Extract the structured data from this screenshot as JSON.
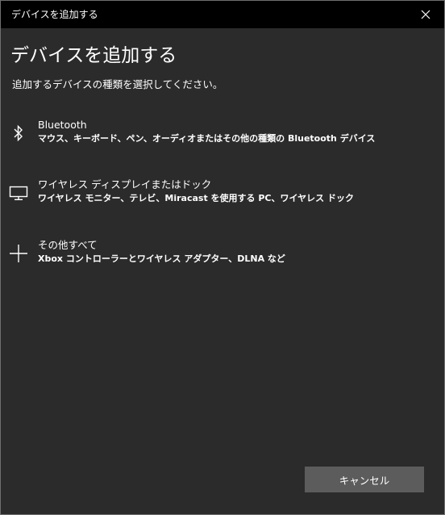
{
  "window": {
    "title": "デバイスを追加する"
  },
  "main": {
    "heading": "デバイスを追加する",
    "instruction": "追加するデバイスの種類を選択してください。",
    "options": [
      {
        "icon": "bluetooth-icon",
        "title": "Bluetooth",
        "description": "マウス、キーボード、ペン、オーディオまたはその他の種類の Bluetooth デバイス"
      },
      {
        "icon": "monitor-icon",
        "title": "ワイヤレス ディスプレイまたはドック",
        "description": "ワイヤレス モニター、テレビ、Miracast を使用する PC、ワイヤレス ドック"
      },
      {
        "icon": "plus-icon",
        "title": "その他すべて",
        "description": "Xbox コントローラーとワイヤレス アダプター、DLNA など"
      }
    ]
  },
  "footer": {
    "cancel_label": "キャンセル"
  },
  "colors": {
    "background": "#2b2b2b",
    "titlebar": "#000000",
    "button": "#5c5c5c",
    "text": "#ffffff"
  }
}
